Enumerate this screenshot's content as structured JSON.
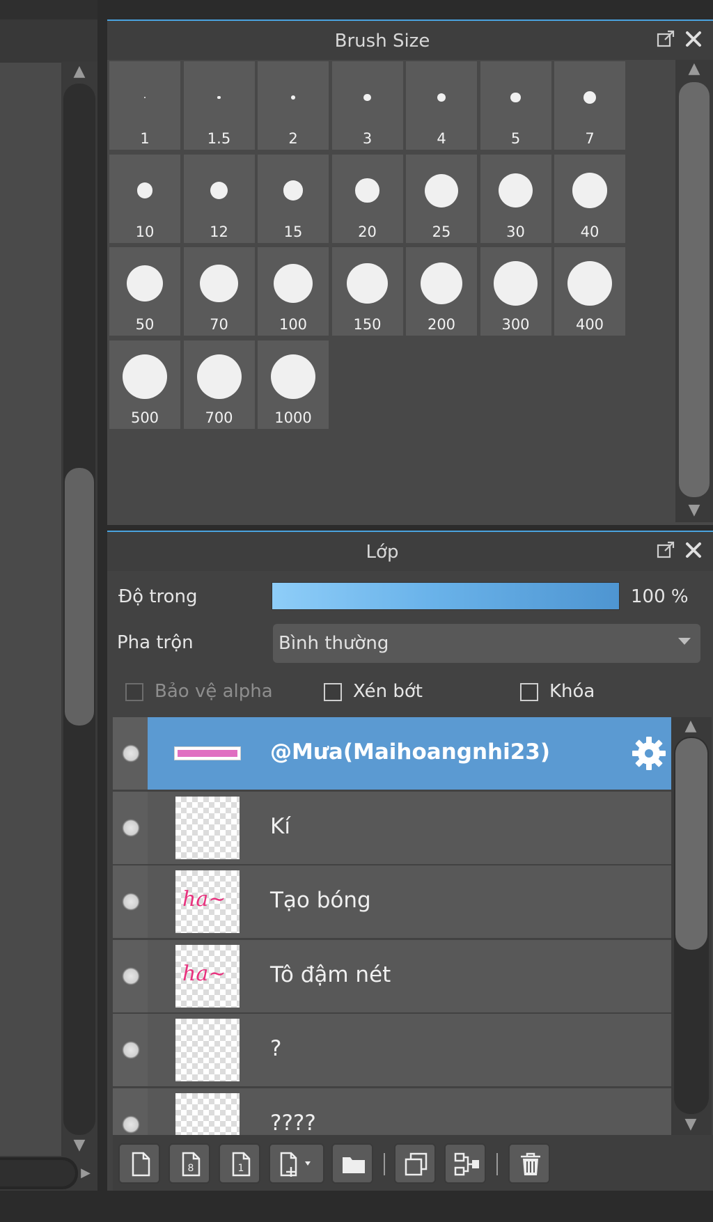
{
  "brush_panel": {
    "title": "Brush Size",
    "sizes": [
      "1",
      "1.5",
      "2",
      "3",
      "4",
      "5",
      "7",
      "10",
      "12",
      "15",
      "20",
      "25",
      "30",
      "40",
      "50",
      "70",
      "100",
      "150",
      "200",
      "300",
      "400",
      "500",
      "700",
      "1000"
    ]
  },
  "layer_panel": {
    "title": "Lớp",
    "opacity_label": "Độ trong",
    "opacity_value": "100 %",
    "opacity_level": 1.0,
    "blend_label": "Pha trộn",
    "blend_value": "Bình thường",
    "checkboxes": {
      "protect_alpha": "Bảo vệ alpha",
      "clipping": "Xén bớt",
      "lock": "Khóa"
    },
    "layers": [
      {
        "name": "@Mưa(Maihoangnhi23)",
        "selected": true
      },
      {
        "name": "Kí",
        "selected": false
      },
      {
        "name": "Tạo bóng",
        "selected": false
      },
      {
        "name": "Tô đậm nét",
        "selected": false
      },
      {
        "name": "?",
        "selected": false
      },
      {
        "name": "????",
        "selected": false
      }
    ]
  },
  "icons": {
    "popout": "popout-icon",
    "close": "close-icon",
    "gear": "gear-icon"
  },
  "colors": {
    "accent": "#4aa3df",
    "selected_row": "#5b9ad2",
    "thumb_pink": "#e8327e"
  }
}
